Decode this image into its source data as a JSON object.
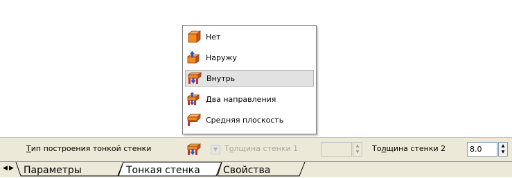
{
  "menu": {
    "items": [
      {
        "label": "Нет",
        "icon": "wall-none-icon"
      },
      {
        "label": "Наружу",
        "icon": "wall-outward-icon"
      },
      {
        "label": "Внутрь",
        "icon": "wall-inward-icon",
        "selected": true
      },
      {
        "label": "Два направления",
        "icon": "wall-both-directions-icon"
      },
      {
        "label": "Средняя плоскость",
        "icon": "wall-midplane-icon"
      }
    ]
  },
  "panel": {
    "type_label_u": "Т",
    "type_label_rest": "ип построения тонкой стенки",
    "thickness1_label_pre": "Т",
    "thickness1_label_u": "о",
    "thickness1_label_post": "лщина стенки 1",
    "thickness1_value": "",
    "thickness2_label_pre": "То",
    "thickness2_label_u": "л",
    "thickness2_label_post": "щина стенки 2",
    "thickness2_value": "8.0"
  },
  "tabs": {
    "items": [
      "Параметры",
      "Тонкая стенка",
      "Свойства"
    ],
    "active": "Тонкая стенка"
  },
  "colors": {
    "panel_bg": "#ece9d8",
    "icon_orange": "#f28a1c",
    "icon_red": "#c8322a",
    "icon_blue": "#3a4fb0"
  }
}
